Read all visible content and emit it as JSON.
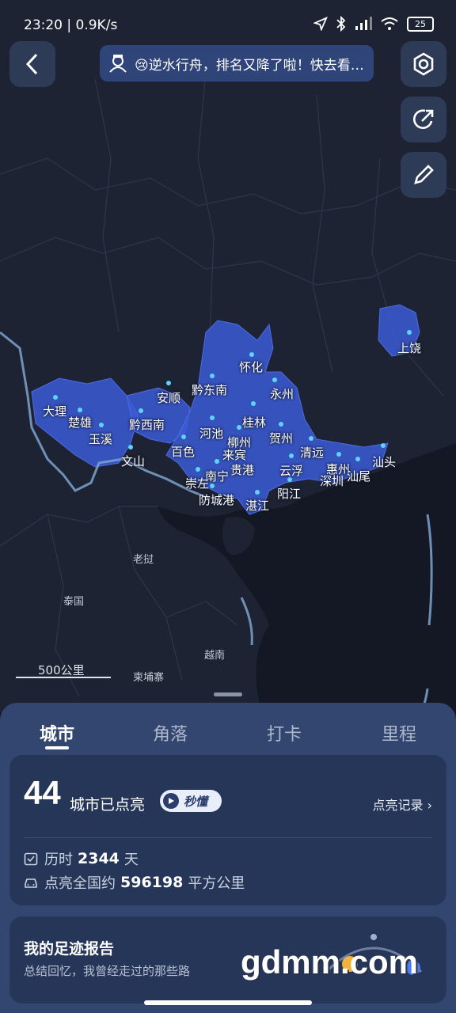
{
  "status": {
    "time": "23:20 | 0.9K/s",
    "battery": "25"
  },
  "ticker": {
    "text": "😢逆水行舟，排名又降了啦！快去看…"
  },
  "map": {
    "cities": [
      {
        "name": "上饶"
      },
      {
        "name": "怀化"
      },
      {
        "name": "黔东南"
      },
      {
        "name": "安顺"
      },
      {
        "name": "永州"
      },
      {
        "name": "大理"
      },
      {
        "name": "楚雄"
      },
      {
        "name": "黔西南"
      },
      {
        "name": "桂林"
      },
      {
        "name": "玉溪"
      },
      {
        "name": "河池"
      },
      {
        "name": "贺州"
      },
      {
        "name": "柳州"
      },
      {
        "name": "文山"
      },
      {
        "name": "百色"
      },
      {
        "name": "来宾"
      },
      {
        "name": "清远"
      },
      {
        "name": "贵港"
      },
      {
        "name": "云浮"
      },
      {
        "name": "惠州"
      },
      {
        "name": "汕头"
      },
      {
        "name": "南宁"
      },
      {
        "name": "崇左"
      },
      {
        "name": "深圳"
      },
      {
        "name": "汕尾"
      },
      {
        "name": "阳江"
      },
      {
        "name": "防城港"
      },
      {
        "name": "湛江"
      }
    ],
    "countries": [
      {
        "name": "老挝"
      },
      {
        "name": "泰国"
      },
      {
        "name": "越南"
      },
      {
        "name": "柬埔寨"
      }
    ],
    "scale_label": "500公里",
    "region_color": "#3b5bd6",
    "point_color": "#5fd3ff"
  },
  "panel": {
    "tabs": [
      {
        "label": "城市"
      },
      {
        "label": "角落"
      },
      {
        "label": "打卡"
      },
      {
        "label": "里程"
      }
    ],
    "summary": {
      "count": "44",
      "count_label": "城市已点亮",
      "explain_label": "秒懂",
      "record_link": "点亮记录",
      "days_prefix": "历时",
      "days_value": "2344",
      "days_unit": "天",
      "area_prefix": "点亮全国约",
      "area_value": "596198",
      "area_unit": "平方公里"
    },
    "report": {
      "title": "我的足迹报告",
      "subtitle": "总结回忆，我曾经走过的那些路"
    }
  },
  "watermark": "gdmm.com"
}
